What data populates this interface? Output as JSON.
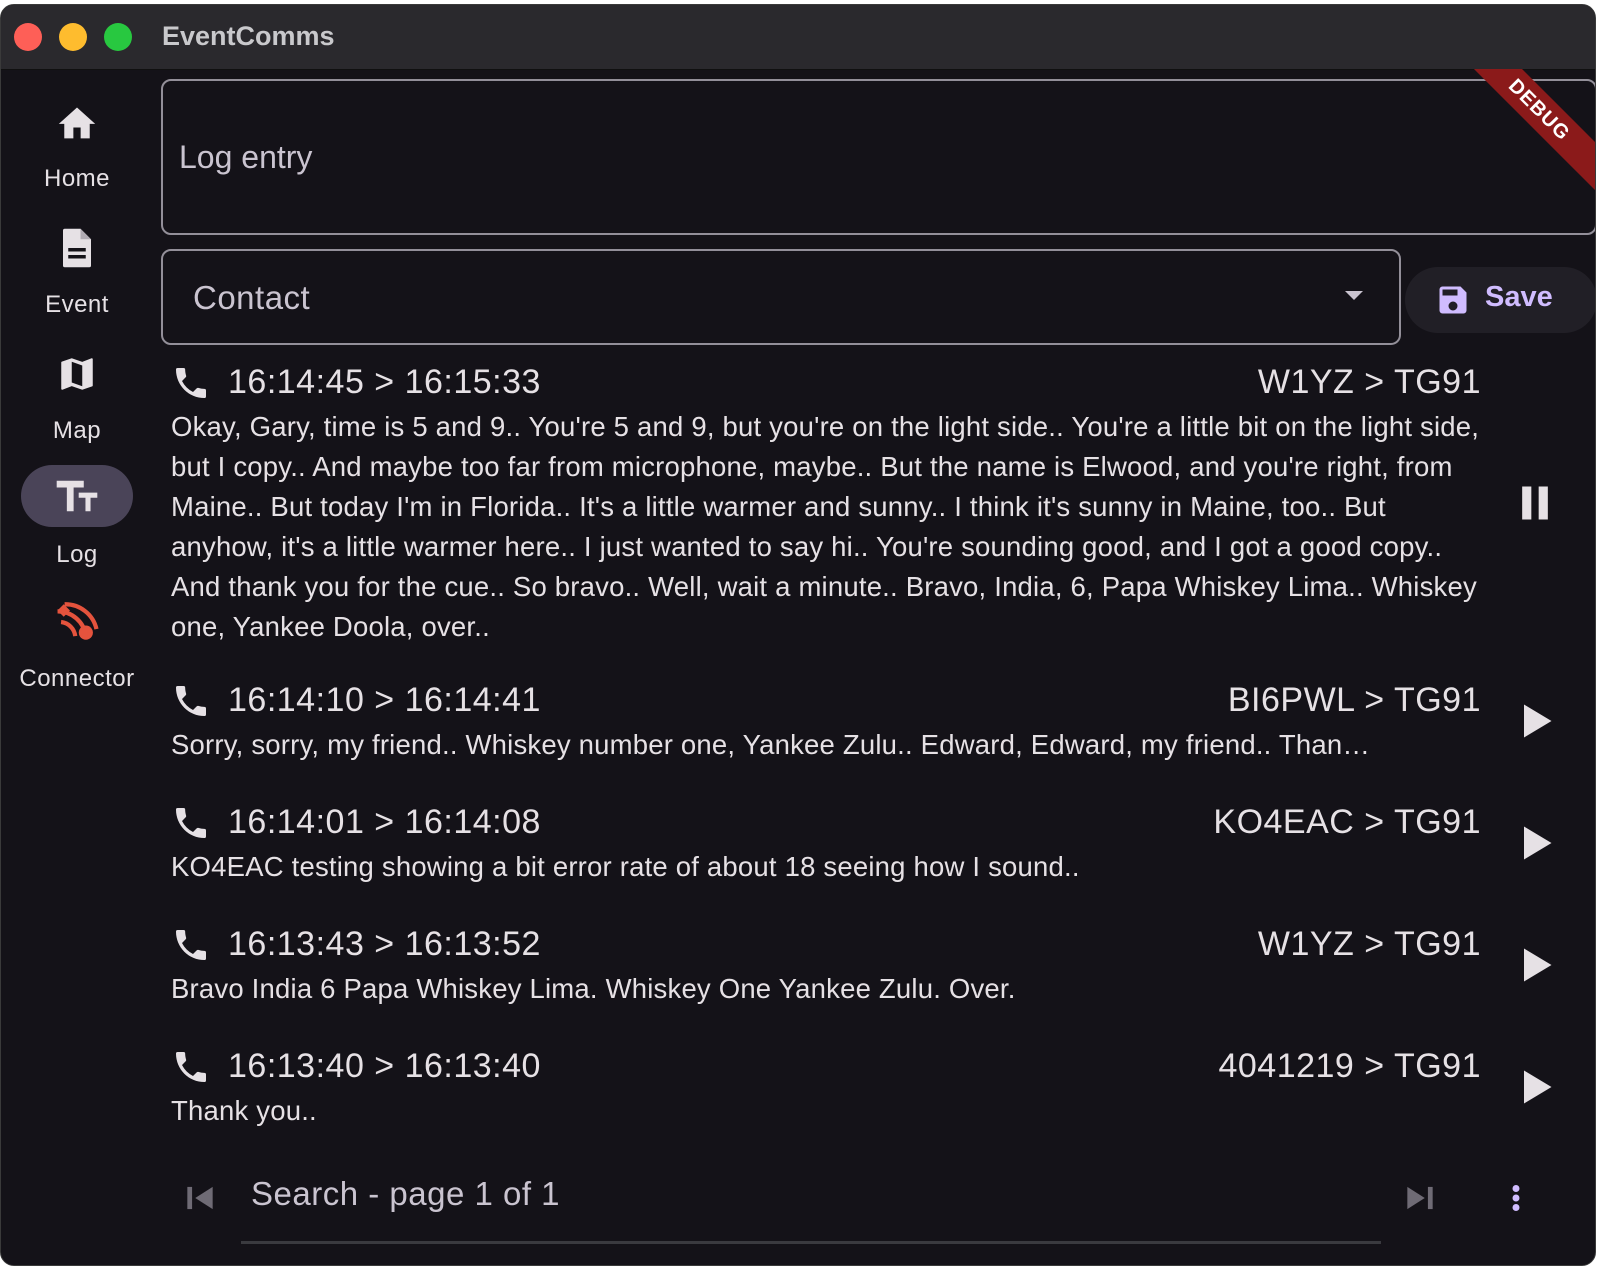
{
  "window": {
    "title": "EventComms"
  },
  "rail": {
    "items": [
      {
        "label": "Home",
        "icon": "home-icon",
        "active": false
      },
      {
        "label": "Event",
        "icon": "document-icon",
        "active": false
      },
      {
        "label": "Map",
        "icon": "map-icon",
        "active": false
      },
      {
        "label": "Log",
        "icon": "text-fields-icon",
        "active": true
      },
      {
        "label": "Connector",
        "icon": "connector-icon",
        "active": false
      }
    ]
  },
  "debug_banner": "DEBUG",
  "log_entry": {
    "placeholder": "Log entry",
    "value": ""
  },
  "contact": {
    "label": "Contact"
  },
  "save": {
    "label": "Save"
  },
  "entries": [
    {
      "time": "16:14:45 > 16:15:33",
      "route": "W1YZ > TG91",
      "text": "Okay, Gary, time is 5 and 9.. You're 5 and 9, but you're on the light side.. You're a little bit on the light side, but I copy.. And maybe too far from microphone, maybe.. But the name is Elwood, and you're right, from Maine.. But today I'm in Florida.. It's a little warmer and sunny.. I think it's sunny in Maine, too.. But anyhow, it's a little warmer here.. I just wanted to say hi.. You're sounding good, and I got a good copy.. And thank you for the cue.. So bravo.. Well, wait a minute.. Bravo, India, 6, Papa Whiskey Lima.. Whiskey one, Yankee Doola, over..",
      "action": "pause"
    },
    {
      "time": "16:14:10 > 16:14:41",
      "route": "BI6PWL > TG91",
      "text": "Sorry, sorry, my friend.. Whiskey number one, Yankee Zulu.. Edward, Edward, my friend.. Than…",
      "action": "play"
    },
    {
      "time": "16:14:01 > 16:14:08",
      "route": "KO4EAC > TG91",
      "text": "KO4EAC testing showing a bit error rate of about 18 seeing how I sound..",
      "action": "play"
    },
    {
      "time": "16:13:43 > 16:13:52",
      "route": "W1YZ > TG91",
      "text": "Bravo India 6 Papa Whiskey Lima. Whiskey One Yankee Zulu. Over.",
      "action": "play"
    },
    {
      "time": "16:13:40 > 16:13:40",
      "route": "4041219 > TG91",
      "text": "Thank you..",
      "action": "play"
    }
  ],
  "footer": {
    "page_label": "Search - page 1 of 1"
  },
  "colors": {
    "background": "#141218",
    "accent": "#d0bcff",
    "connector_status": "#e5533d",
    "active_indicator": "#4a4458"
  }
}
